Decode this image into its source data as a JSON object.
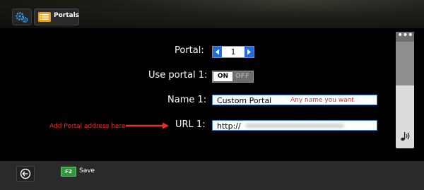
{
  "header": {
    "settings_icon": "gears-icon",
    "tab_label": "Portals",
    "tab_icon": "list-icon"
  },
  "form": {
    "portal_label": "Portal:",
    "portal_value": "1",
    "use_portal_label": "Use portal 1:",
    "toggle_on": "ON",
    "toggle_off": "OFF",
    "name_label": "Name 1:",
    "name_value": "Custom Portal",
    "name_note": "Any name you want",
    "url_label": "URL 1:",
    "url_value": "http://",
    "url_note": "Add Portal address here"
  },
  "scrollbar": {
    "more_icon": "ellipsis-icon",
    "sound_icon": "sound-icon"
  },
  "footer": {
    "back_icon": "back-icon",
    "save_key": "F2",
    "save_label": "Save"
  },
  "colors": {
    "accent_blue": "#1e6fd8",
    "note_red": "#e53030",
    "f2_green": "#2f9a3a"
  }
}
